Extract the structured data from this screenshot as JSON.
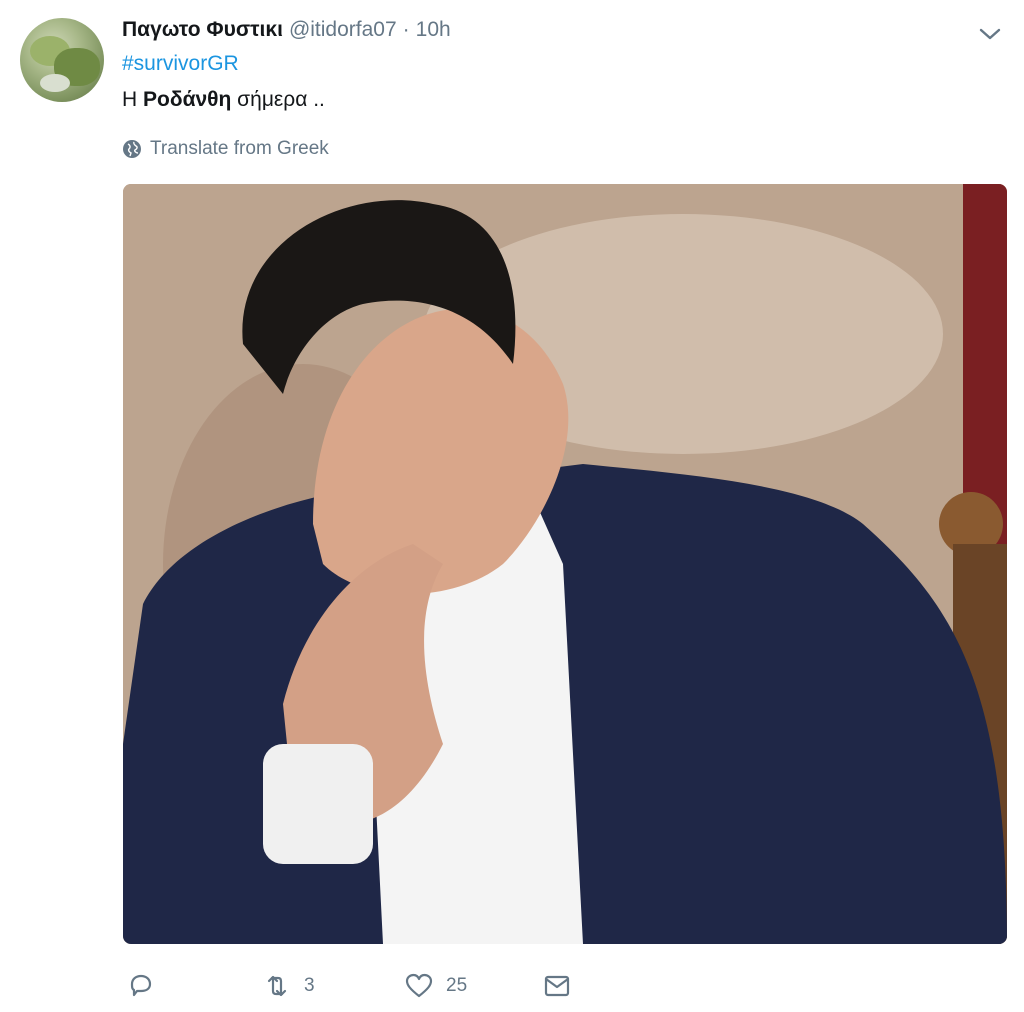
{
  "tweet": {
    "display_name": "Παγωτο Φυστικι",
    "handle": "@itidorfa07",
    "separator": "·",
    "time": "10h",
    "hashtag": "#survivorGR",
    "text_prefix": "Η ",
    "text_bold": "Ροδάνθη",
    "text_suffix": " σήμερα ..",
    "translate_label": "Translate from Greek"
  },
  "actions": {
    "reply_icon": "reply-icon",
    "retweet_icon": "retweet-icon",
    "retweet_count": "3",
    "like_icon": "heart-icon",
    "like_count": "25",
    "message_icon": "envelope-icon"
  },
  "colors": {
    "link": "#1b95e0",
    "secondary": "#657786",
    "primary_text": "#14171a"
  }
}
